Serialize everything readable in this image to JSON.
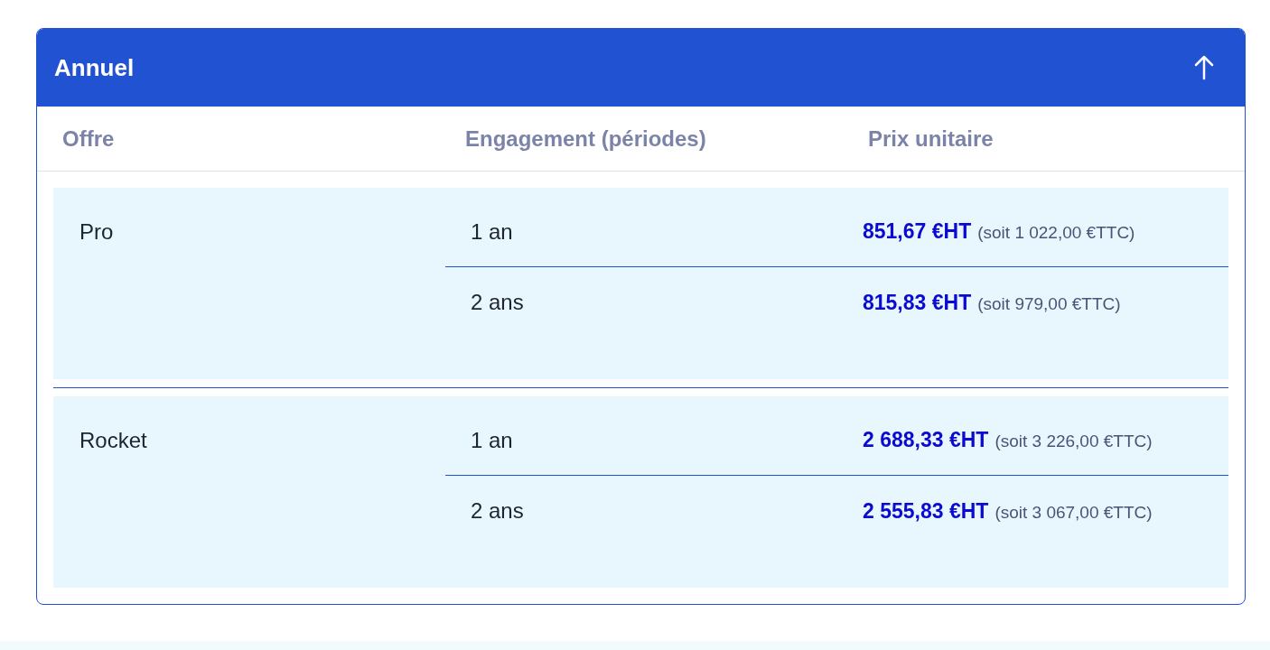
{
  "panel": {
    "title": "Annuel",
    "expanded": true
  },
  "columns": [
    "Offre",
    "Engagement (périodes)",
    "Prix unitaire"
  ],
  "offers": [
    {
      "name": "Pro",
      "rows": [
        {
          "period": "1 an",
          "price_ht": "851,67 €HT",
          "price_ttc": "(soit 1 022,00 €TTC)"
        },
        {
          "period": "2 ans",
          "price_ht": "815,83 €HT",
          "price_ttc": "(soit 979,00 €TTC)"
        }
      ]
    },
    {
      "name": "Rocket",
      "rows": [
        {
          "period": "1 an",
          "price_ht": "2 688,33 €HT",
          "price_ttc": "(soit 3 226,00 €TTC)"
        },
        {
          "period": "2 ans",
          "price_ht": "2 555,83 €HT",
          "price_ttc": "(soit 3 067,00 €TTC)"
        }
      ]
    }
  ]
}
